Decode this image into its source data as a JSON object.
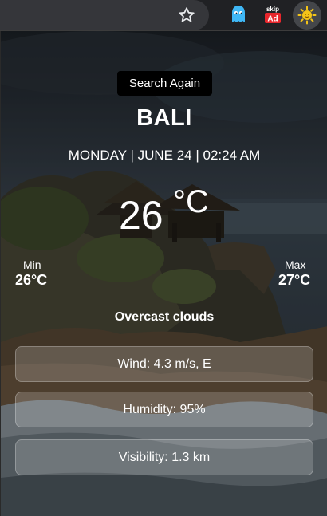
{
  "browser": {
    "bookmark_icon": "star-outline-icon",
    "extensions": [
      {
        "name": "ghost-extension-icon",
        "color": "#3fb7f5"
      },
      {
        "name": "skip-ad-extension",
        "top_text": "skip",
        "badge_text": "Ad",
        "badge_color": "#e8262c"
      },
      {
        "name": "sun-weather-extension-icon",
        "color": "#f5c518"
      }
    ]
  },
  "weather": {
    "search_button_label": "Search Again",
    "city": "BALI",
    "datetime": "MONDAY | JUNE 24 | 02:24 AM",
    "temperature": "26",
    "unit": "°C",
    "min_label": "Min",
    "min_value": "26°C",
    "max_label": "Max",
    "max_value": "27°C",
    "description": "Overcast clouds",
    "stats": {
      "wind": "Wind: 4.3 m/s, E",
      "humidity": "Humidity: 95%",
      "visibility": "Visibility: 1.3 km"
    }
  }
}
